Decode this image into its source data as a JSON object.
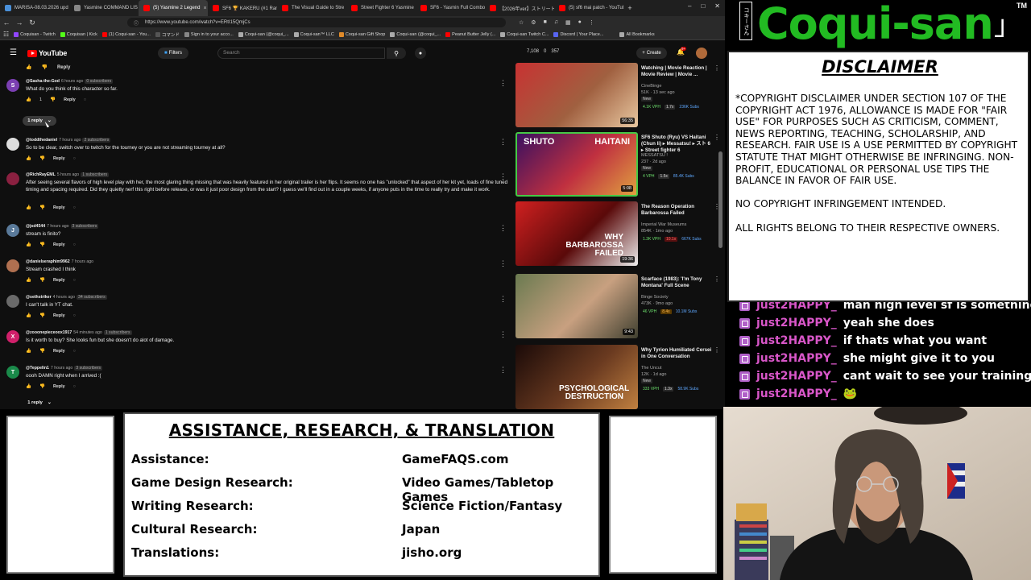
{
  "browser": {
    "tabs": [
      {
        "label": "MARISA-08.03.2026 upd",
        "color": "#4a90d9"
      },
      {
        "label": "Yasmine COMMAND LIS",
        "color": "#888"
      },
      {
        "label": "(5) Yasmine 2 Legend",
        "color": "#ff0000",
        "active": true
      },
      {
        "label": "SF6 🏆 KAKERU (#1 Rank",
        "color": "#ff0000"
      },
      {
        "label": "The Visual Guide to Stre",
        "color": "#ff0000"
      },
      {
        "label": "Street Fighter 6 Yasmine",
        "color": "#ff0000"
      },
      {
        "label": "SF6 - Yasmin Full Combo",
        "color": "#ff0000"
      },
      {
        "label": "【2026年ver】ストリートファイ",
        "color": "#ff0000"
      },
      {
        "label": "(5) sf6 mai patch - YouTub",
        "color": "#ff0000"
      }
    ],
    "url": "https://www.youtube.com/watch?v=ERtI15QmjCs",
    "bookmarks": [
      {
        "label": "Coquisan - Twitch",
        "color": "#9146ff"
      },
      {
        "label": "Coquisan | Kick",
        "color": "#53fc18"
      },
      {
        "label": "(1) Coqui-san - You...",
        "color": "#ff0000"
      },
      {
        "label": "コマンド",
        "color": "#555"
      },
      {
        "label": "Sign in to your acco...",
        "color": "#888"
      },
      {
        "label": "Coqui-san (@coqui_...",
        "color": "#aaa"
      },
      {
        "label": "Coqui-san™ LLC",
        "color": "#aaa"
      },
      {
        "label": "Coqui-san Gift Shop",
        "color": "#e08a2a"
      },
      {
        "label": "Coqui-san (@coqui_...",
        "color": "#aaa"
      },
      {
        "label": "Peanut Butter Jelly (...",
        "color": "#ff0000"
      },
      {
        "label": "Coqui-san Twitch C...",
        "color": "#aaa"
      },
      {
        "label": "Discord | Your Place...",
        "color": "#5865f2"
      },
      {
        "label": "All Bookmarks",
        "color": "#aaa"
      }
    ]
  },
  "youtube": {
    "logo": "YouTube",
    "filters": "Filters",
    "search_placeholder": "Search",
    "stats": [
      "7,108",
      "0",
      "357"
    ],
    "create": "Create",
    "notif_count": "9+"
  },
  "comments": {
    "top_reply": "Reply",
    "items": [
      {
        "author": "@Sasha-the-God",
        "time": "6 hours ago",
        "subs": "0 subscribers",
        "text": "What do you think of this character so far.",
        "likes": "1",
        "avatar_letter": "S",
        "avatar_color": "#7b3fb2"
      },
      {
        "author": "@toddthedaniel",
        "time": "7 hours ago",
        "subs": "2 subscribers",
        "text": "So to be clear, switch over to twitch for the tourney or you are not streaming tourney at all?",
        "likes": "",
        "avatar_letter": "",
        "avatar_color": "#ddd"
      },
      {
        "author": "@RichRayEML",
        "time": "5 hours ago",
        "subs": "1 subscribers",
        "text": "After seeing several flavors of high level play with her, the most glaring thing missing that was heavily featured in her original trailer is her flips. It seems no one has \"unlocked\" that aspect of her kit yet, loads of fine tuned timing and spacing required. Did they quietly nerf this right before release, or was it just poor design from the start? I guess we'll find out in a couple weeks, if anyone puts in the time to really try and make it work.",
        "likes": "",
        "avatar_letter": "",
        "avatar_color": "#8a2040"
      },
      {
        "author": "@jsd4544",
        "time": "7 hours ago",
        "subs": "3 subscribers",
        "text": "stream is finito?",
        "likes": "",
        "avatar_letter": "J",
        "avatar_color": "#5a7a9a"
      },
      {
        "author": "@danielseraphim9962",
        "time": "7 hours ago",
        "subs": "",
        "text": "Stream crashed I think",
        "likes": "",
        "avatar_letter": "",
        "avatar_color": "#b07050"
      },
      {
        "author": "@sethstriker",
        "time": "4 hours ago",
        "subs": "34 subscribers",
        "text": "I can't talk in YT chat.",
        "likes": "",
        "avatar_letter": "",
        "avatar_color": "#6a6a6a"
      },
      {
        "author": "@zooonepieceoox1917",
        "time": "54 minutes ago",
        "subs": "1 subscribers",
        "text": "Is it worth to buy? She looks fun but she doesn't do alot of damage.",
        "likes": "",
        "avatar_letter": "X",
        "avatar_color": "#d0206a"
      },
      {
        "author": "@Teppelin1",
        "time": "7 hours ago",
        "subs": "3 subscribers",
        "text": "oooh DAMN  right when I arrived :(",
        "likes": "",
        "avatar_letter": "T",
        "avatar_color": "#1a8a4a"
      }
    ],
    "reply_label": "Reply",
    "one_reply": "1 reply"
  },
  "recommendations": [
    {
      "title": "Watching | Movie Reaction | Movie Review | Movie ...",
      "channel": "CineBinge",
      "meta": "51K · 13 sec ago",
      "new": "New",
      "badges": [
        [
          "4.1K VPH",
          "g"
        ],
        [
          "1.7x",
          "w"
        ],
        [
          "236K Subs",
          "b"
        ]
      ],
      "duration": "56:35",
      "thumb_colors": [
        "#c83232",
        "#a06040",
        "#e8c8a0"
      ]
    },
    {
      "title": "SF6 Shuto (Ryu) VS Haitani (Chun li) ▸ Messatsu! ▸ スト 6 ▸ Street fighter 6",
      "channel": "MESSATSU !",
      "meta": "237 · 2d ago",
      "new": "New",
      "badges": [
        [
          "4 VPH",
          "g"
        ],
        [
          "1.5x",
          "w"
        ],
        [
          "85.4K Subs",
          "b"
        ]
      ],
      "duration": "5:08",
      "thumb_colors": [
        "#3a1060",
        "#c03040",
        "#e0a040"
      ],
      "highlight": true,
      "thumb_text_left": "SHUTO",
      "thumb_text_right": "HAITANI"
    },
    {
      "title": "The Reason Operation Barbarossa Failed",
      "channel": "Imperial War Museums",
      "meta": "854K · 1mo ago",
      "new": "",
      "badges": [
        [
          "1.3K VPH",
          "g"
        ],
        [
          "10.1x",
          "r"
        ],
        [
          "667K Subs",
          "b"
        ]
      ],
      "duration": "19:36",
      "thumb_colors": [
        "#d02020",
        "#5a0a0a",
        "#eee"
      ],
      "thumb_caption": "WHY BARBAROSSA FAILED"
    },
    {
      "title": "Scarface (1983): 'I'm Tony Montana' Full Scene",
      "channel": "Binge Society",
      "meta": "473K · 9mo ago",
      "new": "",
      "badges": [
        [
          "46 VPH",
          "g"
        ],
        [
          "8.4x",
          "o"
        ],
        [
          "10.1M Subs",
          "b"
        ]
      ],
      "duration": "9:43",
      "thumb_colors": [
        "#6a7a50",
        "#c8a080",
        "#404030"
      ]
    },
    {
      "title": "Why Tyrion Humiliated Cersei in One Conversation",
      "channel": "The Uncut",
      "meta": "12K · 1d ago",
      "new": "New",
      "badges": [
        [
          "333 VPH",
          "g"
        ],
        [
          "1.3x",
          "w"
        ],
        [
          "58.9K Subs",
          "b"
        ]
      ],
      "duration": "",
      "thumb_colors": [
        "#1a0a08",
        "#6a3a20",
        "#c08040"
      ],
      "thumb_caption": "PSYCHOLOGICAL DESTRUCTION"
    }
  ],
  "overlay": {
    "logo": "Coqui-san",
    "logo_vertical": "コキーさん",
    "tm": "TM",
    "disclaimer_title": "DISCLAIMER",
    "disclaimer_paragraphs": [
      "*COPYRIGHT DISCLAIMER UNDER SECTION 107 OF THE COPYRIGHT ACT 1976, ALLOWANCE IS MADE FOR \"FAIR USE\" FOR PURPOSES SUCH AS CRITICISM, COMMENT, NEWS REPORTING, TEACHING, SCHOLARSHIP, AND RESEARCH. FAIR USE IS A USE PERMITTED BY COPYRIGHT STATUTE THAT MIGHT OTHERWISE BE INFRINGING. NON-PROFIT, EDUCATIONAL OR PERSONAL USE TIPS THE BALANCE IN FAVOR OF FAIR USE.",
      "NO COPYRIGHT INFRINGEMENT INTENDED.",
      "ALL RIGHTS BELONG TO THEIR RESPECTIVE OWNERS."
    ],
    "chat": [
      {
        "user": "just2HAPPY_",
        "msg": "man high level sf is something else"
      },
      {
        "user": "just2HAPPY_",
        "msg": "yeah she does"
      },
      {
        "user": "just2HAPPY_",
        "msg": "if thats what you want"
      },
      {
        "user": "just2HAPPY_",
        "msg": "she might give it to you"
      },
      {
        "user": "just2HAPPY_",
        "msg": "cant wait to see your training arc"
      },
      {
        "user": "just2HAPPY_",
        "msg": "🐸"
      }
    ]
  },
  "credits": {
    "title": "ASSISTANCE, RESEARCH, & TRANSLATION",
    "rows": [
      {
        "label": "Assistance:",
        "value": "GameFAQS.com"
      },
      {
        "label": "Game Design Research:",
        "value": "Video Games/Tabletop Games"
      },
      {
        "label": "Writing Research:",
        "value": "Science Fiction/Fantasy"
      },
      {
        "label": "Cultural Research:",
        "value": "Japan"
      },
      {
        "label": "Translations:",
        "value": "jisho.org"
      }
    ]
  }
}
